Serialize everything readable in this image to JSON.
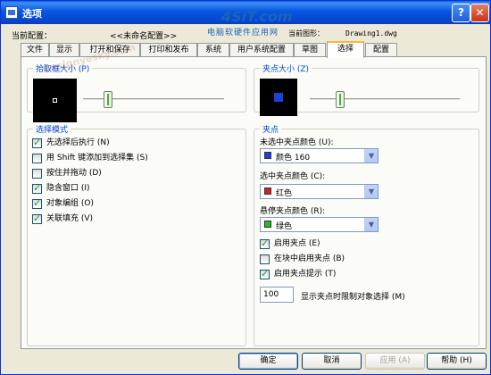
{
  "window": {
    "title": "选项",
    "help_glyph": "?",
    "close_glyph": "✕"
  },
  "logo": {
    "main": "4SiT.com",
    "sub": "电脑软硬件应用网"
  },
  "header": {
    "profile_label": "当前配置：",
    "profile_value": "<<未命名配置>>",
    "drawing_label": "当前图形：",
    "drawing_value": "Drawing1.dwg"
  },
  "tabs": [
    {
      "label": "文件"
    },
    {
      "label": "显示"
    },
    {
      "label": "打开和保存"
    },
    {
      "label": "打印和发布"
    },
    {
      "label": "系统"
    },
    {
      "label": "用户系统配置"
    },
    {
      "label": "草图"
    },
    {
      "label": "选择"
    },
    {
      "label": "配置"
    }
  ],
  "active_tab": "选择",
  "pickbox": {
    "title": "拾取框大小 (P)",
    "slider_level": 0.18
  },
  "grip_size": {
    "title": "夹点大小 (Z)",
    "slider_level": 0.2
  },
  "selection_modes": {
    "title": "选择模式",
    "items": [
      {
        "label": "先选择后执行 (N)",
        "checked": true
      },
      {
        "label": "用 Shift 键添加到选择集 (S)",
        "checked": false
      },
      {
        "label": "按住并拖动 (D)",
        "checked": false
      },
      {
        "label": "隐含窗口 (I)",
        "checked": true
      },
      {
        "label": "对象编组 (O)",
        "checked": true
      },
      {
        "label": "关联填充 (V)",
        "checked": true
      }
    ]
  },
  "grips": {
    "title": "夹点",
    "unselected_label": "未选中夹点颜色 (U):",
    "unselected_value": "颜色 160",
    "unselected_color": "#1d40d8",
    "selected_label": "选中夹点颜色 (C):",
    "selected_value": "红色",
    "selected_color": "#d62020",
    "hover_label": "悬停夹点颜色 (R):",
    "hover_value": "绿色",
    "hover_color": "#22c022",
    "options": [
      {
        "label": "启用夹点 (E)",
        "checked": true
      },
      {
        "label": "在块中启用夹点 (B)",
        "checked": false
      },
      {
        "label": "启用夹点提示 (T)",
        "checked": true
      }
    ],
    "limit_value": "100",
    "limit_label": "显示夹点时限制对象选择 (M)"
  },
  "buttons": {
    "ok": "确定",
    "cancel": "取消",
    "apply": "应用 (A)",
    "help": "帮助 (H)"
  },
  "watermark": "Designyesky.com"
}
